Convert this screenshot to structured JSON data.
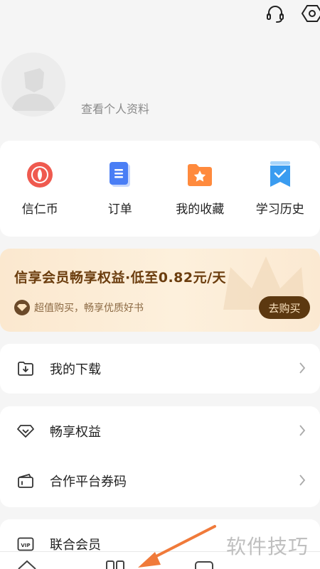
{
  "header": {
    "icons": [
      "headset-icon",
      "settings-hex-icon"
    ]
  },
  "profile": {
    "view_profile_label": "查看个人资料"
  },
  "quick_actions": [
    {
      "label": "信仁币",
      "icon": "coin-icon",
      "color": "#ef5a4f"
    },
    {
      "label": "订单",
      "icon": "order-doc-icon",
      "color": "#4a7ef5"
    },
    {
      "label": "我的收藏",
      "icon": "favorites-folder-icon",
      "color": "#ff8a3d"
    },
    {
      "label": "学习历史",
      "icon": "history-bookmark-icon",
      "color": "#3a9cf0"
    }
  ],
  "vip_banner": {
    "title": "信享会员畅享权益·低至0.82元/天",
    "subtitle": "超值购买，畅享优质好书",
    "button_label": "去购买"
  },
  "menu": {
    "downloads_label": "我的下载",
    "benefits_label": "畅享权益",
    "partner_code_label": "合作平台券码",
    "joint_member_label": "联合会员"
  },
  "watermark": "软件技巧",
  "colors": {
    "background": "#f5f5f5",
    "vip_text": "#6b3d0e",
    "vip_button": "#5c3810",
    "arrow": "#f07a3a"
  }
}
